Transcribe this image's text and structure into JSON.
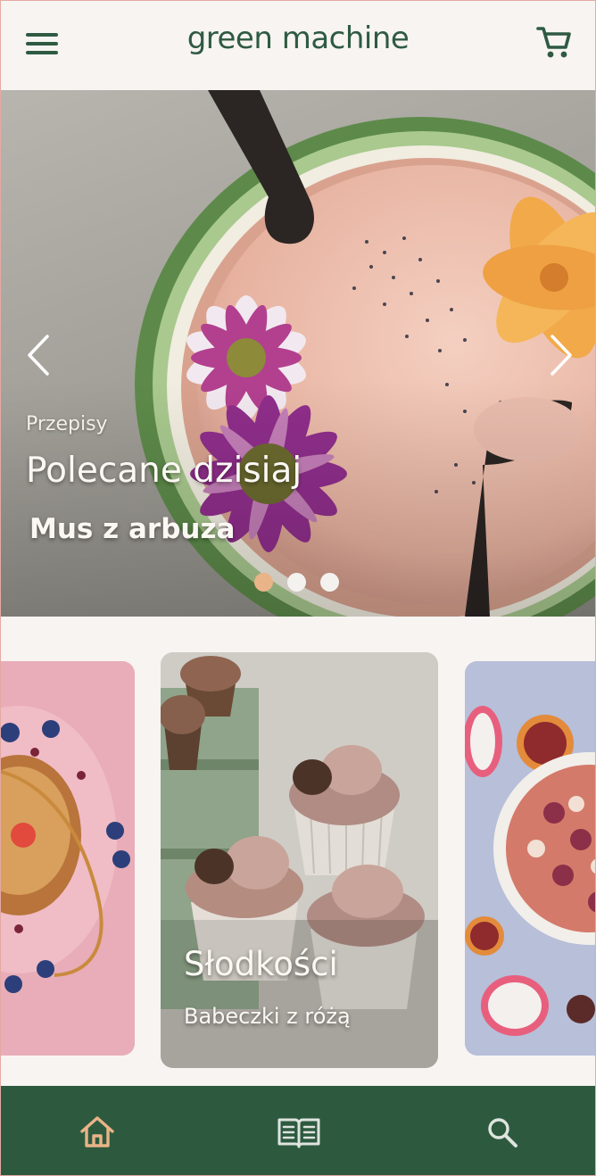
{
  "header": {
    "app_title": "green machine",
    "menu_icon": "hamburger-menu-icon",
    "cart_icon": "shopping-cart-icon"
  },
  "hero": {
    "category": "Przepisy",
    "heading": "Polecane dzisiaj",
    "recipe_name": "Mus z arbuza",
    "prev_icon": "chevron-left-icon",
    "next_icon": "chevron-right-icon",
    "slides": 3,
    "active_slide": 1
  },
  "cards": [
    {
      "title": "",
      "subtitle": ""
    },
    {
      "title": "Słodkości",
      "subtitle": "Babeczki z różą"
    },
    {
      "title": "",
      "subtitle": ""
    }
  ],
  "bottom_nav": {
    "items": [
      {
        "icon": "home-icon",
        "active": true
      },
      {
        "icon": "book-icon",
        "active": false
      },
      {
        "icon": "search-icon",
        "active": false
      }
    ]
  },
  "colors": {
    "brand_green": "#2f5a42",
    "nav_bg": "#2d5a3f",
    "accent_orange": "#e9b487",
    "nav_icon_inactive": "#dfe4df"
  }
}
